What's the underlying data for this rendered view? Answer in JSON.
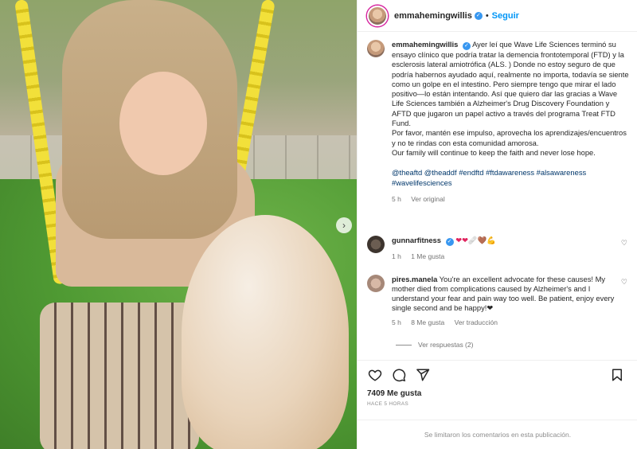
{
  "post": {
    "username": "emmahemingwillis",
    "follow_label": "Seguir",
    "caption_lines": [
      "Ayer leí que Wave Life Sciences terminó su ensayo clínico que podría tratar la demencia frontotemporal (FTD) y la esclerosis lateral amiotrófica (ALS. ) Donde no estoy seguro de que podría habernos ayudado aquí, realmente no importa, todavía se siente como un golpe en el intestino. Pero siempre tengo que mirar el lado positivo—lo están intentando. Así que quiero dar las gracias a Wave Life Sciences también a Alzheimer's Drug Discovery Foundation y AFTD que jugaron un papel activo a través del programa Treat FTD Fund.",
      "Por favor, mantén ese impulso, aprovecha los aprendizajes/encuentros y no te rindas con esta comunidad amorosa.",
      "Our family will continue to keep the faith and never lose hope."
    ],
    "hashtags": "@theaftd @theaddf #endftd #ftdawareness #alsawareness #wavelifesciences",
    "time": "5 h",
    "see_original": "Ver original",
    "likes": "7409 Me gusta",
    "posted_ago": "HACE 5 HORAS",
    "comments_disabled": "Se limitaron los comentarios en esta publicación."
  },
  "comments": [
    {
      "username": "gunnarfitness",
      "text": "❤❤🩹🤎💪",
      "time": "1 h",
      "likes": "1 Me gusta"
    },
    {
      "username": "pires.manela",
      "text": "You're an excellent advocate for these causes! My mother died from complications caused by Alzheimer's and I understand your fear and pain way too well. Be patient, enjoy every single second and be happy!❤",
      "time": "5 h",
      "likes": "8 Me gusta",
      "translate": "Ver traducción"
    }
  ],
  "more_replies": "Ver respuestas (2)",
  "colors": {
    "link": "#0095f6",
    "tag": "#00376b",
    "muted": "#737373",
    "like": "#e0245e"
  },
  "icons": [
    "heart-icon",
    "comment-icon",
    "share-icon",
    "bookmark-icon",
    "verified-badge-icon",
    "chevron-right-icon"
  ]
}
